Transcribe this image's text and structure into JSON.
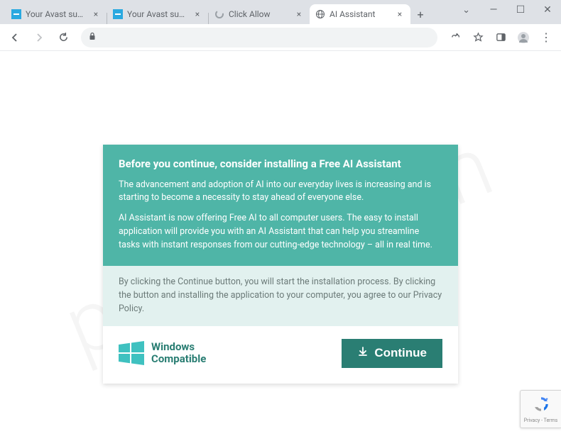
{
  "tabs": [
    {
      "title": "Your Avast subscription",
      "icon": "blue-square"
    },
    {
      "title": "Your Avast subscription",
      "icon": "blue-square"
    },
    {
      "title": "Click Allow",
      "icon": "spinner"
    },
    {
      "title": "AI Assistant",
      "icon": "globe",
      "active": true
    }
  ],
  "newTabLabel": "+",
  "windowControls": {
    "chevron": "⌄",
    "minimize": "—",
    "maximize": "☐",
    "close": "✕"
  },
  "toolbar": {
    "back": "←",
    "forward": "→",
    "reload": "↻",
    "menu": "⋮"
  },
  "card": {
    "heading": "Before you continue, consider installing a Free AI Assistant",
    "p1": "The advancement and adoption of AI into our everyday lives is increasing and is starting to become a necessity to stay ahead of everyone else.",
    "p2": "AI Assistant is now offering Free AI to all computer users. The easy to install application will provide you with an AI Assistant that can help you streamline tasks with instant responses from our cutting-edge technology – all in real time.",
    "disclaimer": "By clicking the Continue button, you will start the installation process. By clicking the button and installing the application to your computer, you agree to our Privacy Policy.",
    "compat_line1": "Windows",
    "compat_line2": "Compatible",
    "continue_label": "Continue"
  },
  "recaptcha": {
    "footer": "Privacy - Terms"
  },
  "watermark": "pcrisk.com"
}
